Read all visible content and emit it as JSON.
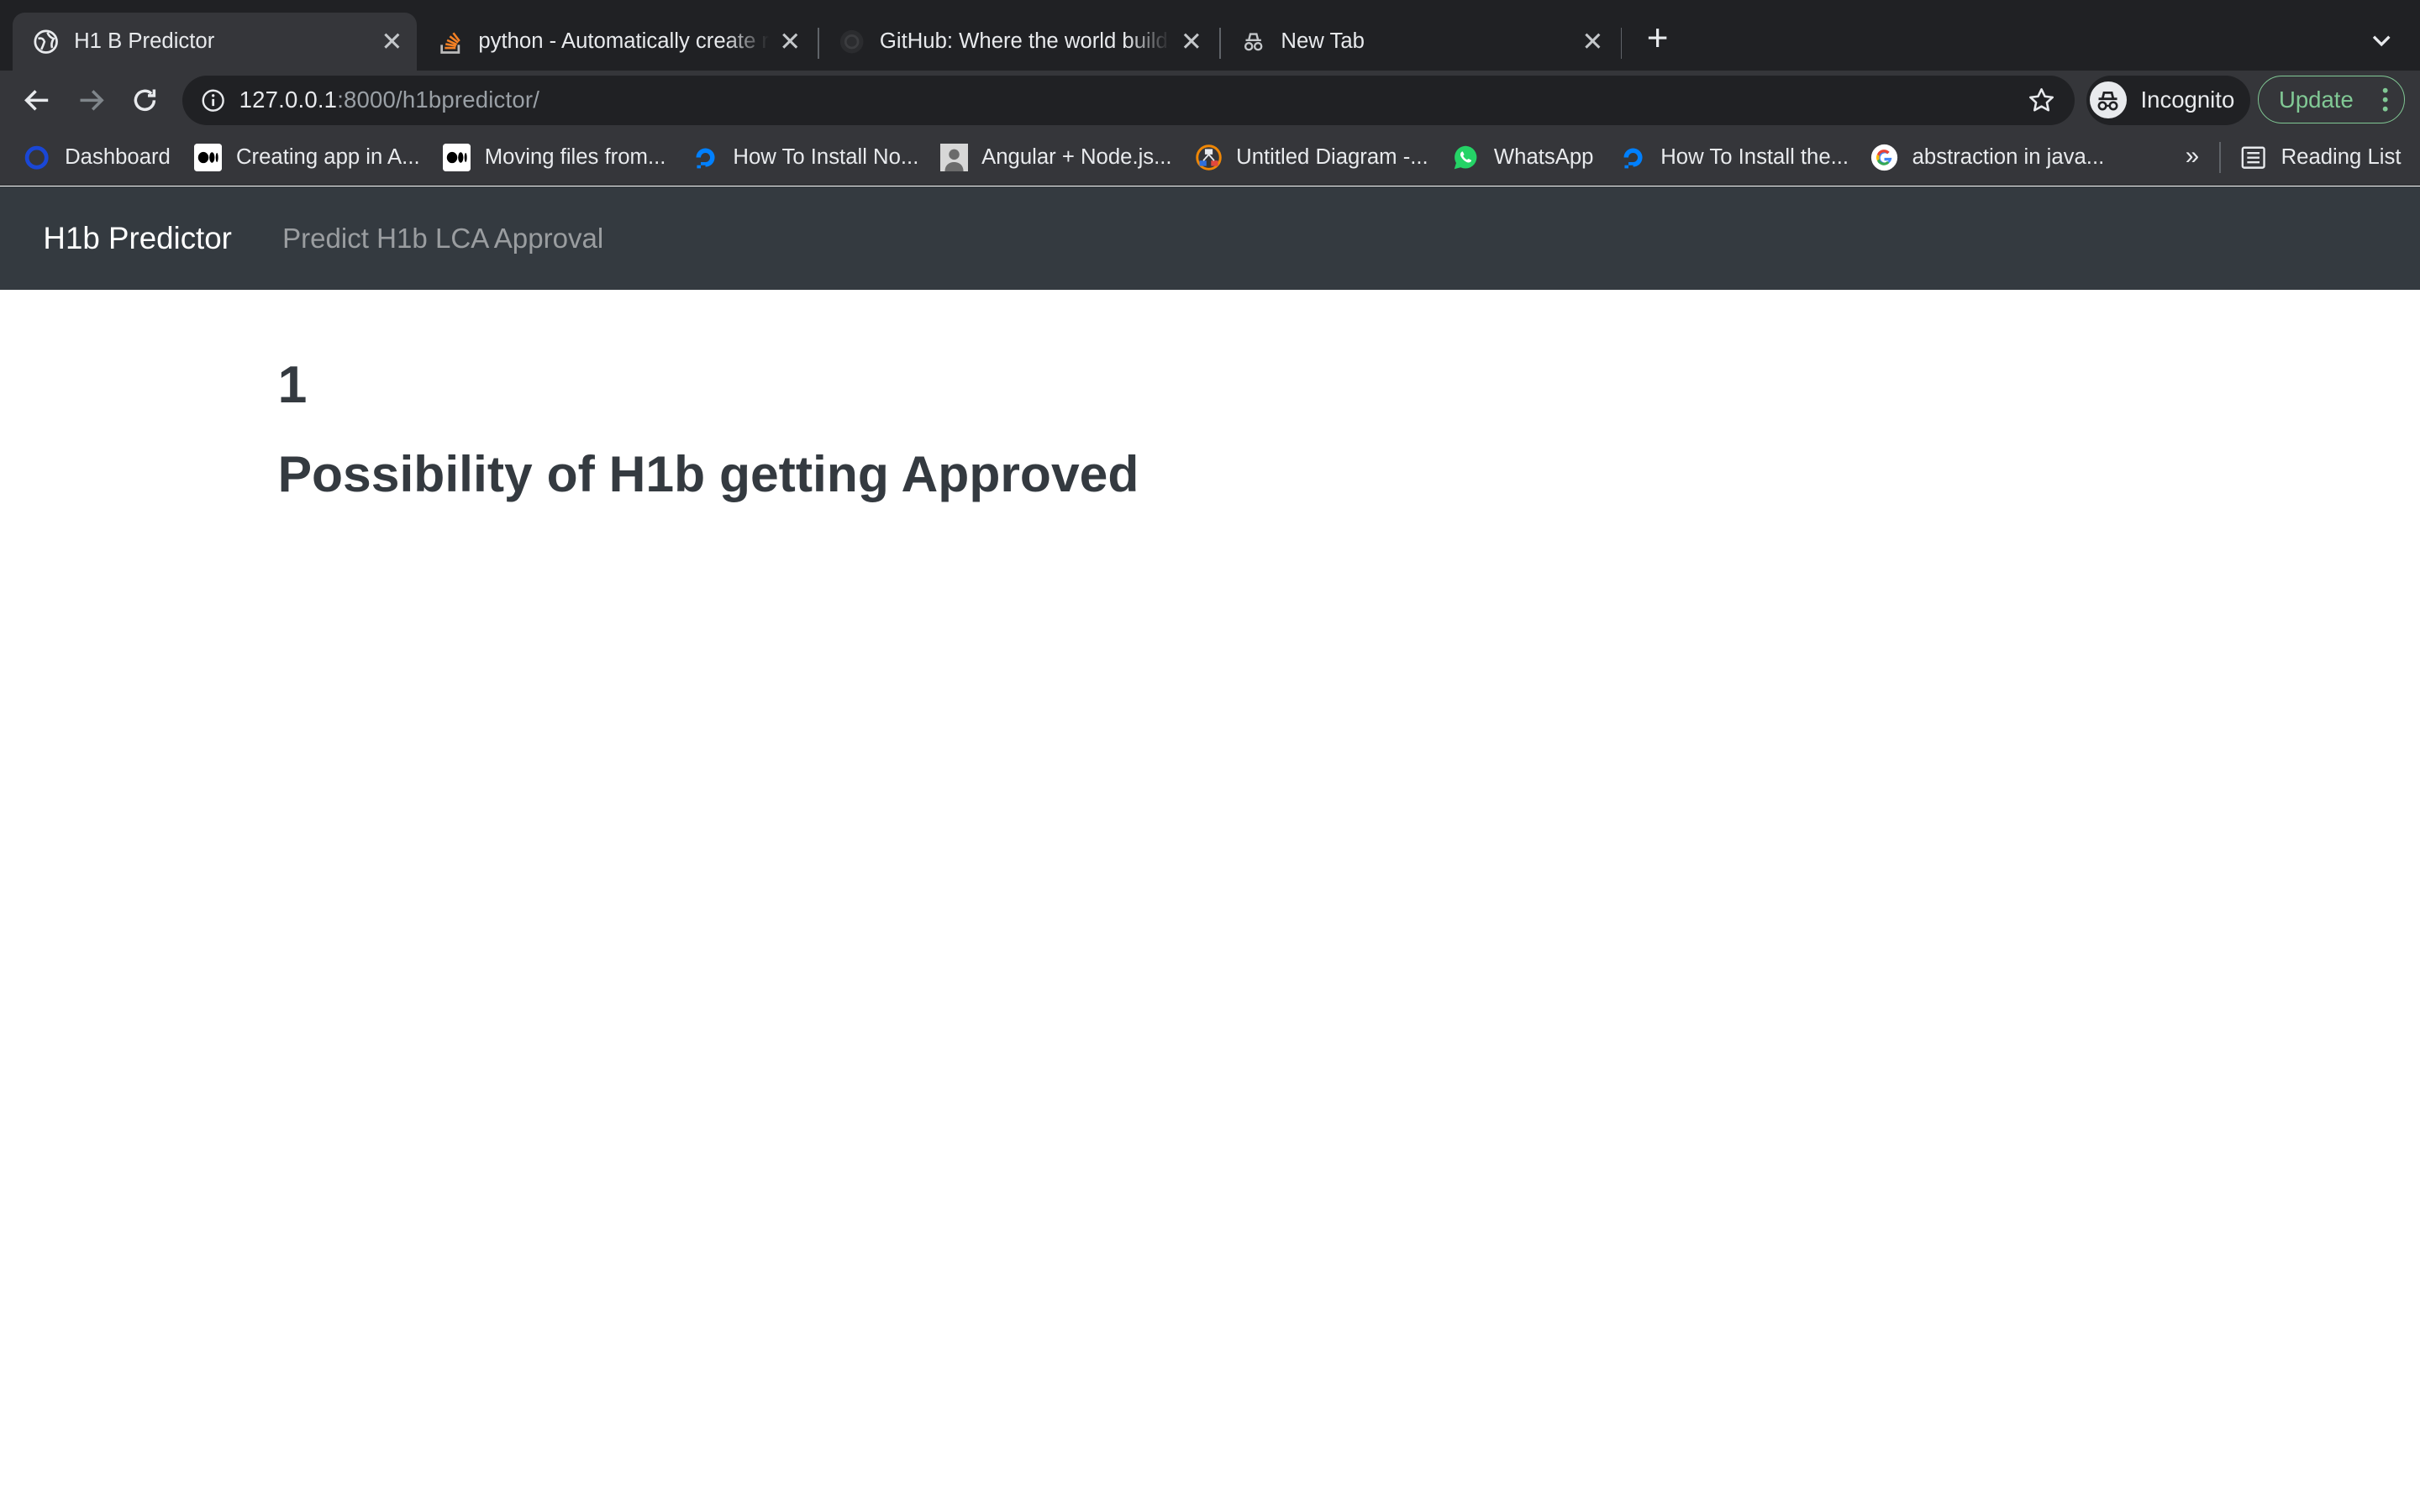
{
  "browser": {
    "tabs": [
      {
        "title": "H1 B Predictor",
        "icon": "globe-icon",
        "active": true
      },
      {
        "title": "python - Automatically create r",
        "icon": "stackoverflow-icon",
        "active": false
      },
      {
        "title": "GitHub: Where the world builds",
        "icon": "github-icon",
        "active": false
      },
      {
        "title": "New Tab",
        "icon": "incognito-icon",
        "active": false
      }
    ],
    "url_host": "127.0.0.1",
    "url_rest": ":8000/h1bpredictor/",
    "profile_label": "Incognito",
    "update_label": "Update",
    "bookmarks": [
      {
        "label": "Dashboard",
        "icon": "dashboard-icon"
      },
      {
        "label": "Creating app in A...",
        "icon": "medium-icon"
      },
      {
        "label": "Moving files from...",
        "icon": "medium-icon"
      },
      {
        "label": "How To Install No...",
        "icon": "digitalocean-icon"
      },
      {
        "label": "Angular + Node.js...",
        "icon": "avatar-icon"
      },
      {
        "label": "Untitled Diagram -...",
        "icon": "drawio-icon"
      },
      {
        "label": "WhatsApp",
        "icon": "whatsapp-icon"
      },
      {
        "label": "How To Install the...",
        "icon": "digitalocean-icon"
      },
      {
        "label": "abstraction in java...",
        "icon": "google-icon"
      }
    ],
    "more_bookmarks": "»",
    "reading_list": "Reading List"
  },
  "page": {
    "brand": "H1b Predictor",
    "nav_link": "Predict H1b LCA Approval",
    "result_value": "1",
    "result_heading": "Possibility of H1b getting Approved"
  },
  "colors": {
    "tabstrip": "#202124",
    "toolbar": "#35363a",
    "navbar": "#343a40",
    "update_accent": "#81c995",
    "text_dark": "#343a40"
  }
}
